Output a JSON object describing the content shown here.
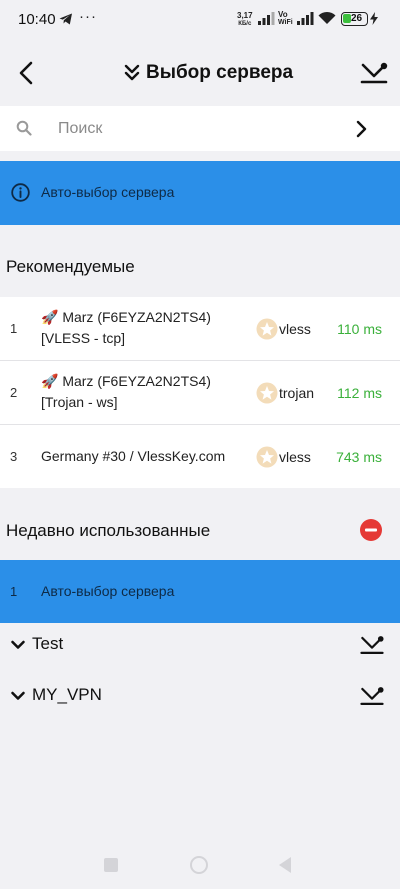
{
  "status_bar": {
    "time": "10:40",
    "dots": "···",
    "speed_value": "3,17",
    "speed_unit": "КБ/с",
    "vo": "Vo",
    "wifi_label": "WiFi",
    "battery": "26",
    "icons": [
      "telegram-icon",
      "signal-icon",
      "wifi-icon",
      "battery-icon",
      "charging-icon"
    ]
  },
  "header": {
    "title": "Выбор сервера",
    "back_icon": "chevron-left-icon",
    "title_icon": "double-chevron-down-icon",
    "action_icon": "collapse-all-icon"
  },
  "search": {
    "placeholder": "Поиск",
    "value": ""
  },
  "auto_select": {
    "label": "Авто-выбор сервера",
    "icon": "info-icon"
  },
  "recommended": {
    "title": "Рекомендуемые",
    "rows": [
      {
        "index": "1",
        "name_line1": "🚀 Marz (F6EYZA2N2TS4)",
        "name_line2": "[VLESS - tcp]",
        "protocol": "vless",
        "ping": "110 ms"
      },
      {
        "index": "2",
        "name_line1": "🚀 Marz (F6EYZA2N2TS4)",
        "name_line2": "[Trojan - ws]",
        "protocol": "trojan",
        "ping": "112 ms"
      },
      {
        "index": "3",
        "name_line1": "Germany #30 / VlessKey.com",
        "name_line2": "",
        "protocol": "vless",
        "ping": "743 ms"
      }
    ]
  },
  "recent": {
    "title": "Недавно использованные",
    "clear_icon": "minus-circle-icon",
    "rows": [
      {
        "index": "1",
        "label": "Авто-выбор сервера"
      }
    ]
  },
  "groups": [
    {
      "name": "Test"
    },
    {
      "name": "MY_VPN"
    }
  ],
  "colors": {
    "accent": "#2b8fe8",
    "ping_good": "#3ab03a",
    "danger": "#e53935",
    "background": "#f1f1f4",
    "star": "#f3dcb9"
  }
}
